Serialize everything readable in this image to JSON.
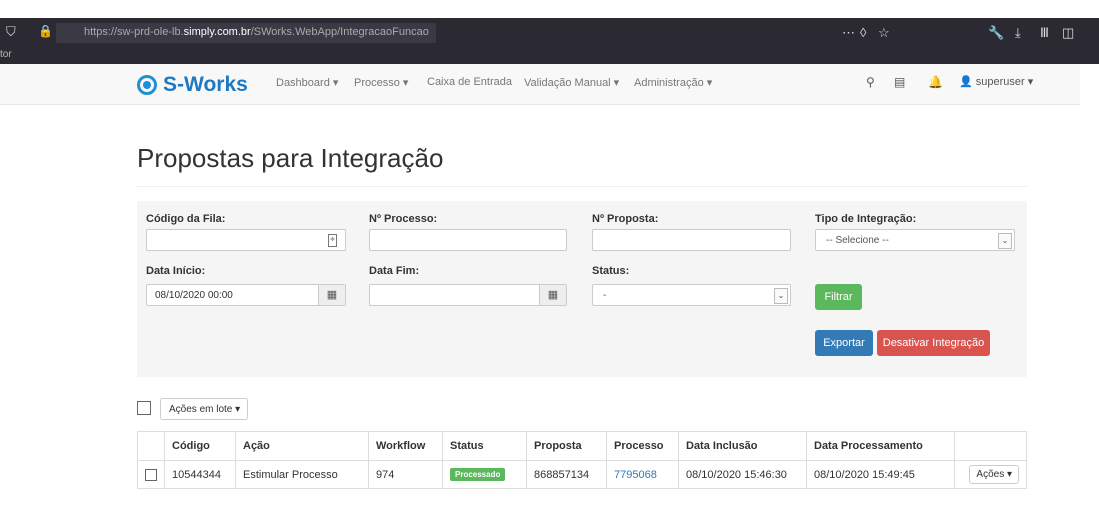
{
  "browser": {
    "url_prefix": "https://sw-prd-ole-lb.",
    "url_host": "simply.com.br",
    "url_path": "/SWorks.WebApp/IntegracaoFuncao",
    "left_fragment": "tor"
  },
  "nav": {
    "brand": "S-Works",
    "items": [
      "Dashboard ▾",
      "Processo ▾",
      "Caixa de Entrada",
      "Validação Manual ▾",
      "Administração ▾"
    ],
    "user": "superuser ▾"
  },
  "page": {
    "title": "Propostas para Integração"
  },
  "filters": {
    "codigo_fila_label": "Código da Fila:",
    "processo_label": "Nº Processo:",
    "proposta_label": "Nº Proposta:",
    "tipo_label": "Tipo de Integração:",
    "tipo_value": "-- Selecione --",
    "data_inicio_label": "Data Início:",
    "data_inicio_value": "08/10/2020 00:00",
    "data_fim_label": "Data Fim:",
    "status_label": "Status:",
    "status_value": "-",
    "filtrar": "Filtrar",
    "exportar": "Exportar",
    "desativar": "Desativar Integração"
  },
  "bulk": {
    "label": "Ações em lote ▾"
  },
  "table": {
    "headers": [
      "Código",
      "Ação",
      "Workflow",
      "Status",
      "Proposta",
      "Processo",
      "Data Inclusão",
      "Data Processamento"
    ],
    "rows": [
      {
        "codigo": "10544344",
        "acao": "Estimular Processo",
        "workflow": "974",
        "status": "Processado",
        "proposta": "868857134",
        "processo": "7795068",
        "data_inclusao": "08/10/2020 15:46:30",
        "data_processamento": "08/10/2020 15:49:45",
        "acoes": "Ações ▾"
      }
    ]
  },
  "colors": {
    "filtrar": "#5cb85c",
    "exportar": "#337ab7",
    "desativar": "#d9534f",
    "brand": "#1e78c2",
    "badge": "#5cb85c"
  }
}
